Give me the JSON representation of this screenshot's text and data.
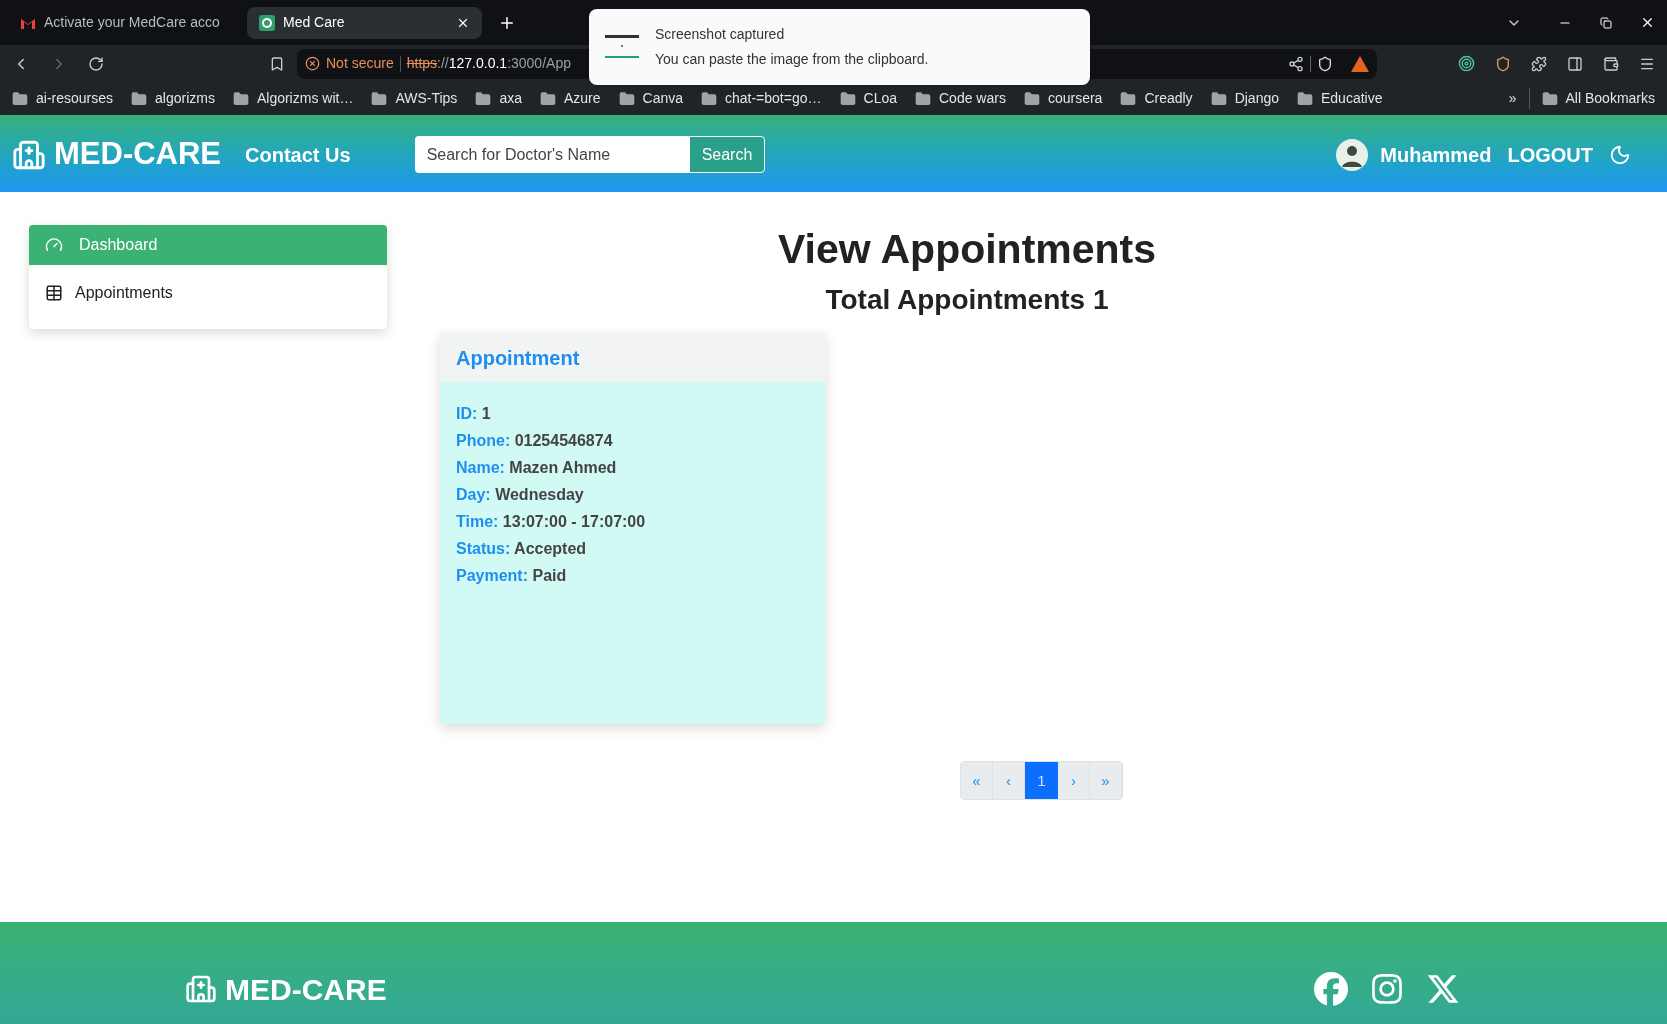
{
  "browser": {
    "tabs": [
      {
        "title": "Activate your MedCare acco",
        "selected": false,
        "kind": "mail"
      },
      {
        "title": "Med Care",
        "selected": true,
        "kind": "site"
      }
    ],
    "address": {
      "security": "Not secure",
      "scheme": "https",
      "separator": "://",
      "host": "127.0.0.1",
      "rest": ":3000/App"
    },
    "bookmarks": [
      "ai-resourses",
      "algorizms",
      "Algorizms wit…",
      "AWS-Tips",
      "axa",
      "Azure",
      "Canva",
      "chat-=bot=go…",
      "CLoa",
      "Code wars",
      "coursera",
      "Creadly",
      "Django",
      "Educative"
    ],
    "overflow": "»",
    "all_bookmarks": "All Bookmarks"
  },
  "notification": {
    "title": "Screenshot captured",
    "message": "You can paste the image from the clipboard."
  },
  "header": {
    "brand": "MED-CARE",
    "nav_link": "Contact Us",
    "search": {
      "placeholder": "Search for Doctor's Name",
      "button": "Search"
    },
    "user": "Muhammed",
    "logout": "LOGOUT"
  },
  "sidebar": {
    "items": [
      {
        "label": "Dashboard",
        "selected": true,
        "kind": "gauge"
      },
      {
        "label": "Appointments",
        "selected": false,
        "kind": "table"
      }
    ]
  },
  "page": {
    "title": "View Appointments",
    "total": "Total Appointments 1"
  },
  "card": {
    "title": "Appointment",
    "fields": [
      {
        "label": "ID:",
        "value": "1"
      },
      {
        "label": "Phone:",
        "value": "01254546874"
      },
      {
        "label": "Name:",
        "value": "Mazen Ahmed"
      },
      {
        "label": "Day:",
        "value": "Wednesday"
      },
      {
        "label": "Time:",
        "value": "13:07:00 - 17:07:00"
      },
      {
        "label": "Status:",
        "value": "Accepted"
      },
      {
        "label": "Payment:",
        "value": "Paid"
      }
    ]
  },
  "pagination": [
    {
      "label": "«",
      "selected": false
    },
    {
      "label": "‹",
      "selected": false
    },
    {
      "label": "1",
      "selected": true
    },
    {
      "label": "›",
      "selected": false
    },
    {
      "label": "»",
      "selected": false
    }
  ],
  "footer": {
    "brand": "MED-CARE",
    "socials": [
      {
        "kind": "facebook"
      },
      {
        "kind": "instagram"
      },
      {
        "kind": "x"
      }
    ]
  }
}
